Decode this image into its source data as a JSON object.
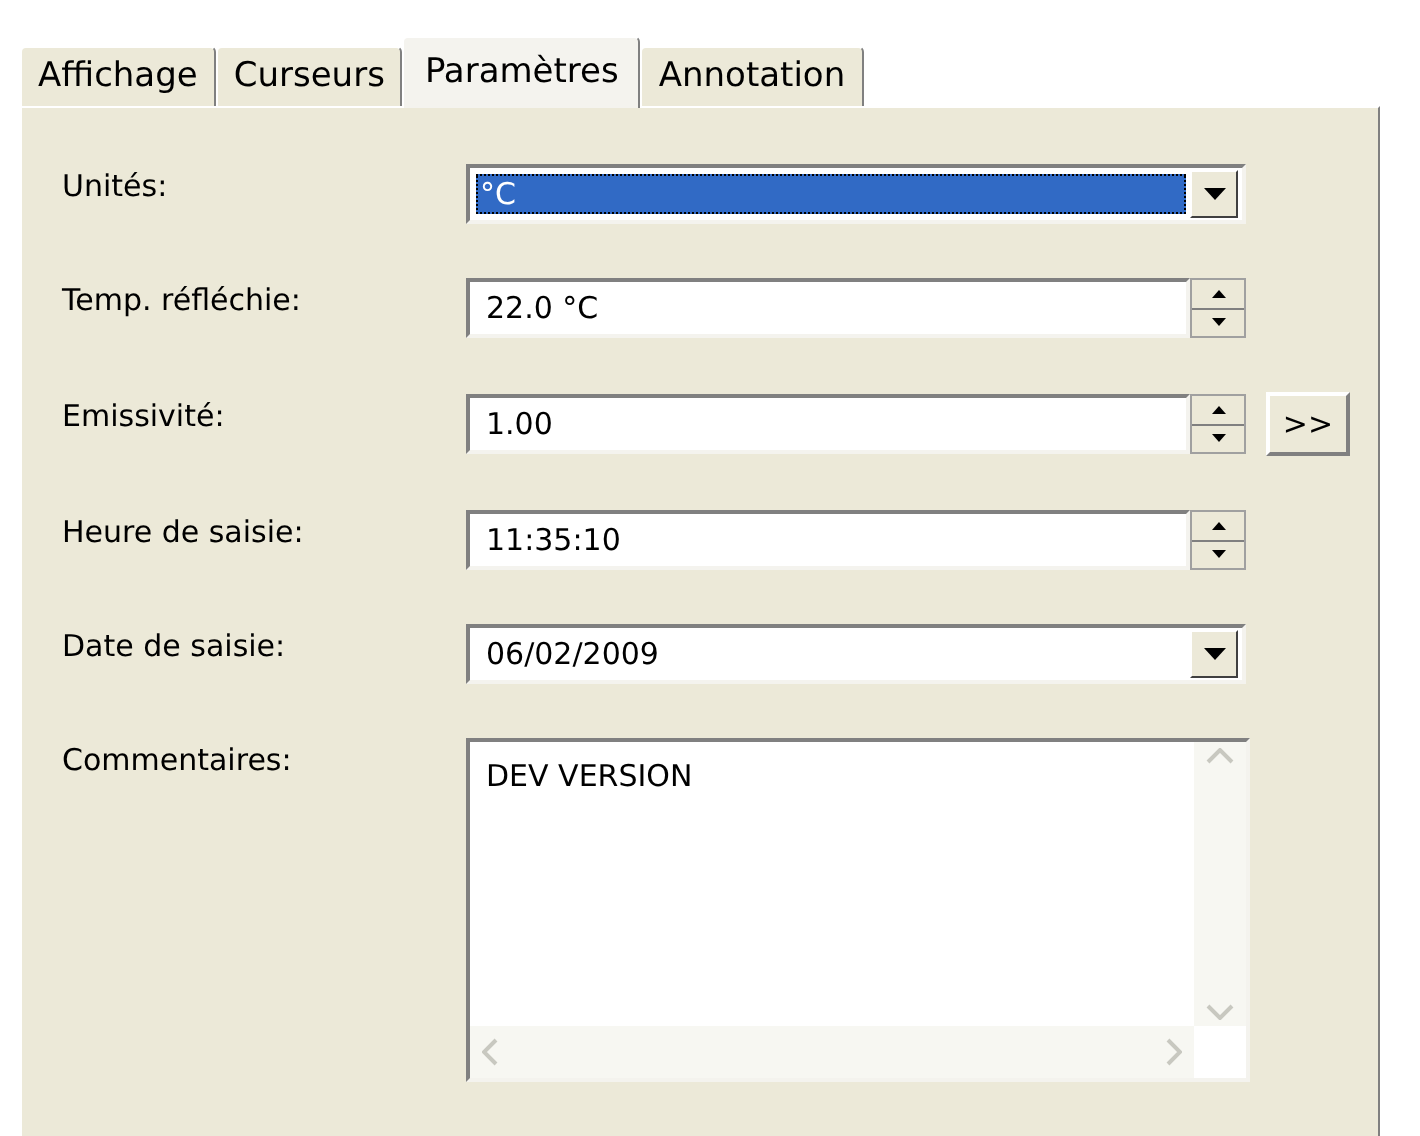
{
  "tabs": [
    {
      "label": "Affichage",
      "selected": false
    },
    {
      "label": "Curseurs",
      "selected": false
    },
    {
      "label": "Paramètres",
      "selected": true
    },
    {
      "label": "Annotation",
      "selected": false
    }
  ],
  "fields": [
    {
      "label": "Unités:",
      "kind": "dropdown",
      "value": "°C",
      "focused": true
    },
    {
      "label": "Temp. réfléchie:",
      "kind": "spin",
      "value": "22.0 °C",
      "focused": false
    },
    {
      "label": "Emissivité:",
      "kind": "spin",
      "value": "1.00",
      "focused": false,
      "extra_button": ">>"
    },
    {
      "label": "Heure de saisie:",
      "kind": "spin",
      "value": "11:35:10",
      "focused": false
    },
    {
      "label": "Date de saisie:",
      "kind": "dropdown",
      "value": "06/02/2009",
      "focused": false
    }
  ],
  "comments": {
    "label": "Commentaires:",
    "value": "DEV VERSION"
  }
}
